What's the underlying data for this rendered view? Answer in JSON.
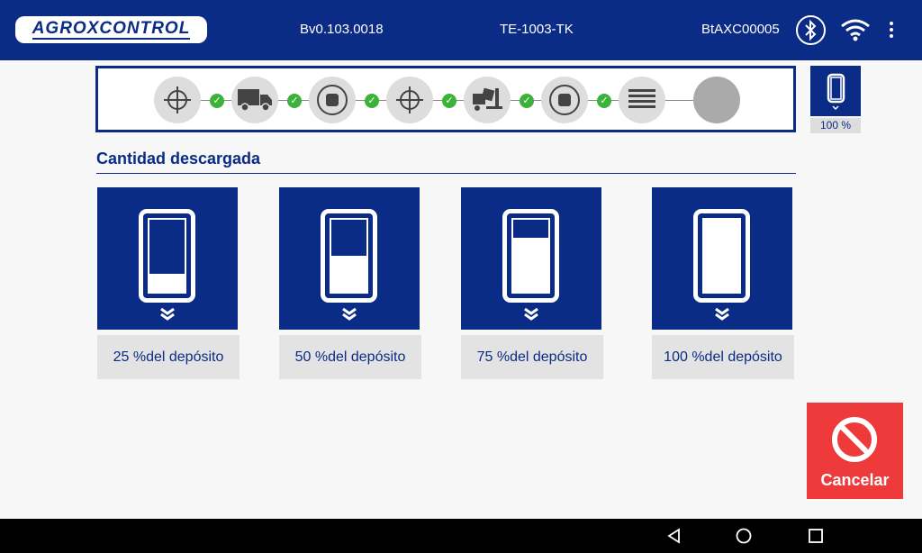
{
  "header": {
    "logo_text": "AGROXCONTROL",
    "version": "Bv0.103.0018",
    "device": "TE-1003-TK",
    "device_id": "BtAXC00005",
    "bg_color": "#0a2b86"
  },
  "steps": {
    "icons": [
      "crosshair-icon",
      "truck-icon",
      "stop-icon",
      "crosshair-icon",
      "forklift-icon",
      "stop-icon",
      "lines-icon",
      "empty-circle"
    ],
    "check_color": "#3bb33b"
  },
  "side_tank": {
    "percent_label": "100 %"
  },
  "section": {
    "title": "Cantidad descargada"
  },
  "options": [
    {
      "label": "25 %del depósito",
      "fill": 0.25
    },
    {
      "label": "50 %del depósito",
      "fill": 0.5
    },
    {
      "label": "75 %del depósito",
      "fill": 0.75
    },
    {
      "label": "100 %del depósito",
      "fill": 1.0
    }
  ],
  "cancel": {
    "label": "Cancelar",
    "color": "#ee3a3a"
  },
  "navbar": {
    "buttons": [
      "back-icon",
      "home-icon",
      "recents-icon"
    ]
  }
}
